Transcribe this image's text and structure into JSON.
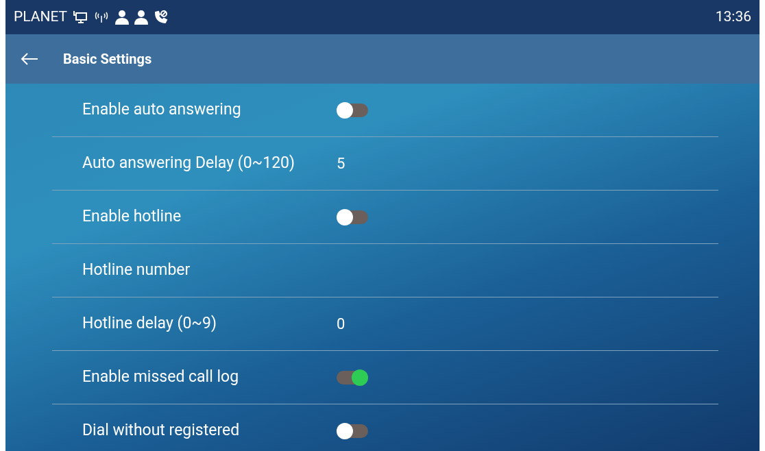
{
  "status_bar": {
    "brand": "PLANET",
    "time": "13:36"
  },
  "header": {
    "title": "Basic Settings"
  },
  "settings": [
    {
      "kind": "toggle",
      "label": "Enable auto answering",
      "on": false
    },
    {
      "kind": "value",
      "label": "Auto answering Delay (0~120)",
      "value": "5"
    },
    {
      "kind": "toggle",
      "label": "Enable hotline",
      "on": false
    },
    {
      "kind": "value",
      "label": "Hotline number"
    },
    {
      "kind": "value",
      "label": "Hotline delay (0~9)",
      "value": "0"
    },
    {
      "kind": "toggle",
      "label": "Enable missed call log",
      "on": true
    },
    {
      "kind": "toggle",
      "label": "Dial without registered",
      "on": false
    }
  ]
}
